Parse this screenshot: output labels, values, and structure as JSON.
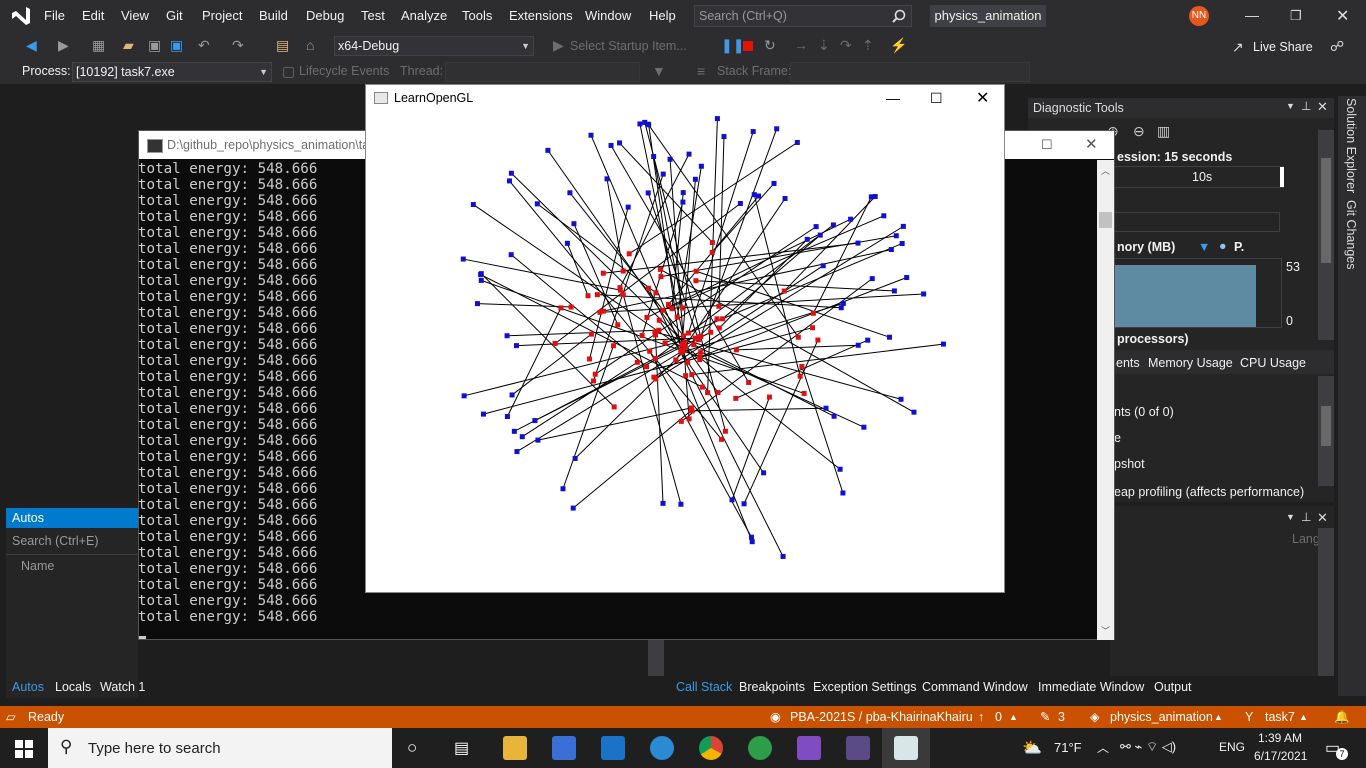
{
  "menu": {
    "items": [
      "File",
      "Edit",
      "View",
      "Git",
      "Project",
      "Build",
      "Debug",
      "Test",
      "Analyze",
      "Tools",
      "Extensions",
      "Window",
      "Help"
    ],
    "search_placeholder": "Search (Ctrl+Q)",
    "project_title": "physics_animation",
    "user_initials": "NN"
  },
  "toolbar": {
    "configuration": "x64-Debug",
    "startup_item": "Select Startup Item...",
    "live_share": "Live Share",
    "process_label": "Process:",
    "process_value": "[10192] task7.exe",
    "lifecycle_events": "Lifecycle Events",
    "thread_label": "Thread:",
    "stack_frame_label": "Stack Frame:"
  },
  "autos": {
    "title": "Autos",
    "search_placeholder": "Search (Ctrl+E)",
    "column_name": "Name",
    "tabs": [
      "Autos",
      "Locals",
      "Watch 1"
    ]
  },
  "debug_tabs": [
    "Call Stack",
    "Breakpoints",
    "Exception Settings",
    "Command Window",
    "Immediate Window",
    "Output"
  ],
  "diagnostic_tools": {
    "title": "Diagnostic Tools",
    "session": "ession: 15 seconds",
    "timeline_tick": "10s",
    "memory_label": "nory (MB)",
    "legend_label": "P.",
    "memory_max": "53",
    "memory_min": "0",
    "processors_label": "processors)",
    "tabs": [
      "ents",
      "Memory Usage",
      "CPU Usage"
    ],
    "events_label": "nts (0 of 0)",
    "row_e": "e",
    "snapshot_label": "pshot",
    "heap_label": "eap profiling (affects performance)",
    "lang_col": "Lang"
  },
  "right_rail": [
    "Solution Explorer",
    "Git Changes"
  ],
  "console": {
    "title": "D:\\github_repo\\physics_animation\\ta",
    "line_text": "total energy: 548.666",
    "line_count": 29
  },
  "gl_window": {
    "title": "LearnOpenGL"
  },
  "status": {
    "ready": "Ready",
    "repo": "PBA-2021S / pba-KhairinaKhairu",
    "up_count": "0",
    "edit_count": "3",
    "branch_project": "physics_animation",
    "branch": "task7"
  },
  "taskbar": {
    "search_placeholder": "Type here to search",
    "weather": "71°F",
    "language": "ENG",
    "time": "1:39 AM",
    "date": "6/17/2021",
    "notifications": "7"
  },
  "colors": {
    "accent": "#007acc",
    "status_bar": "#ca5100",
    "red_particle": "#e01010",
    "blue_particle": "#1010d0"
  }
}
